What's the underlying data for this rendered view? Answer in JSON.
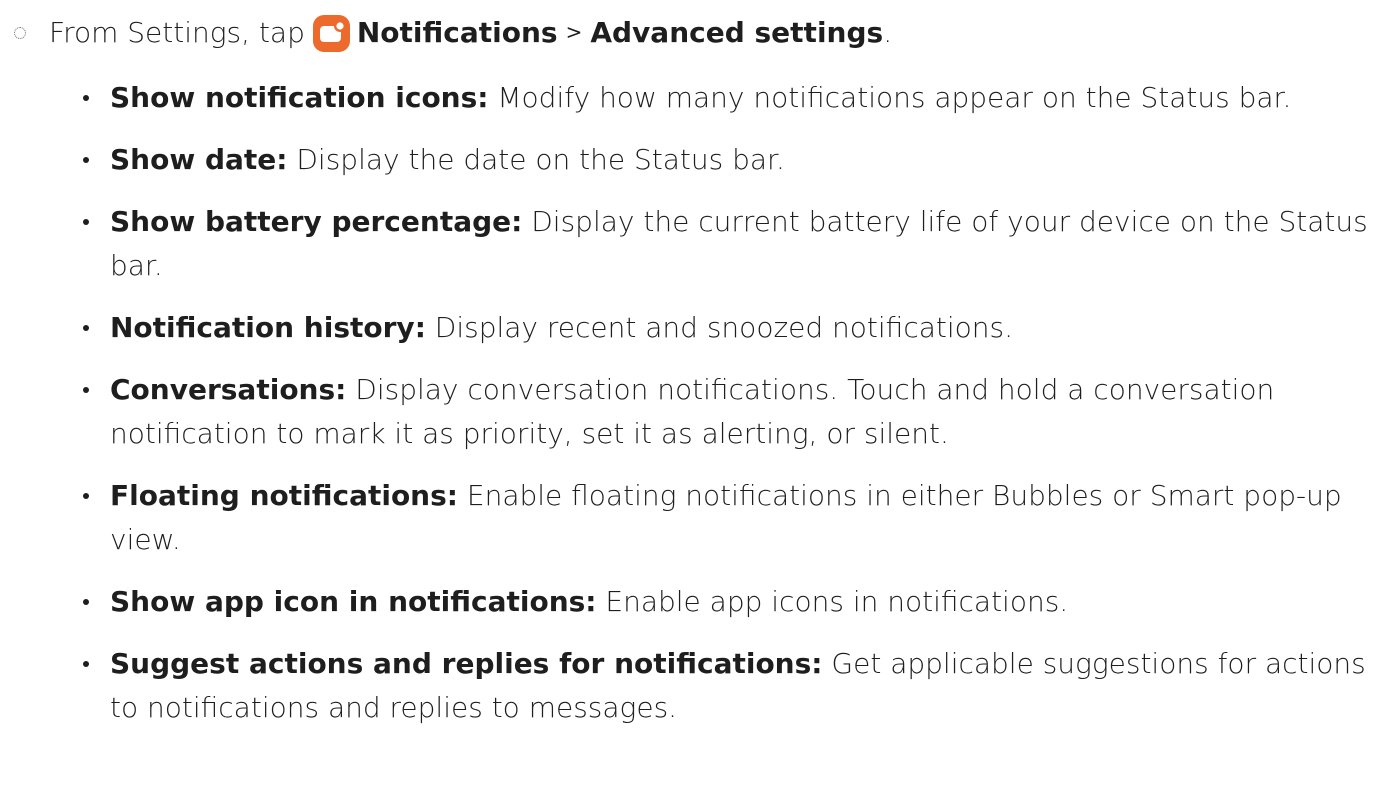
{
  "step": {
    "prefix": "From Settings, tap",
    "icon": "notifications-app-icon",
    "icon_color": "#EC6A2C",
    "menu": "Notifications",
    "separator": ">",
    "submenu": "Advanced settings",
    "end": "."
  },
  "items": [
    {
      "term": "Show notification icons",
      "colon": ":",
      "desc": " Modify how many notifications appear on the Status bar."
    },
    {
      "term": "Show date",
      "colon": ":",
      "desc": " Display the date on the Status bar."
    },
    {
      "term": "Show battery percentage",
      "colon": ":",
      "desc": " Display the current battery life of your device on the Status bar."
    },
    {
      "term": "Notification history",
      "colon": ":",
      "desc": " Display recent and snoozed notifications."
    },
    {
      "term": "Conversations",
      "colon": ":",
      "desc": " Display conversation notifications. Touch and hold a conversation notification to mark it as priority, set it as alerting, or silent."
    },
    {
      "term": "Floating notifications",
      "colon": ":",
      "desc": " Enable floating notifications in either Bubbles or Smart pop-up view."
    },
    {
      "term": "Show app icon in notifications",
      "colon": ":",
      "desc": " Enable app icons in notifications."
    },
    {
      "term": "Suggest actions and replies for notifications",
      "colon": ":",
      "desc": " Get applicable suggestions for actions to notifications and replies to messages."
    }
  ]
}
